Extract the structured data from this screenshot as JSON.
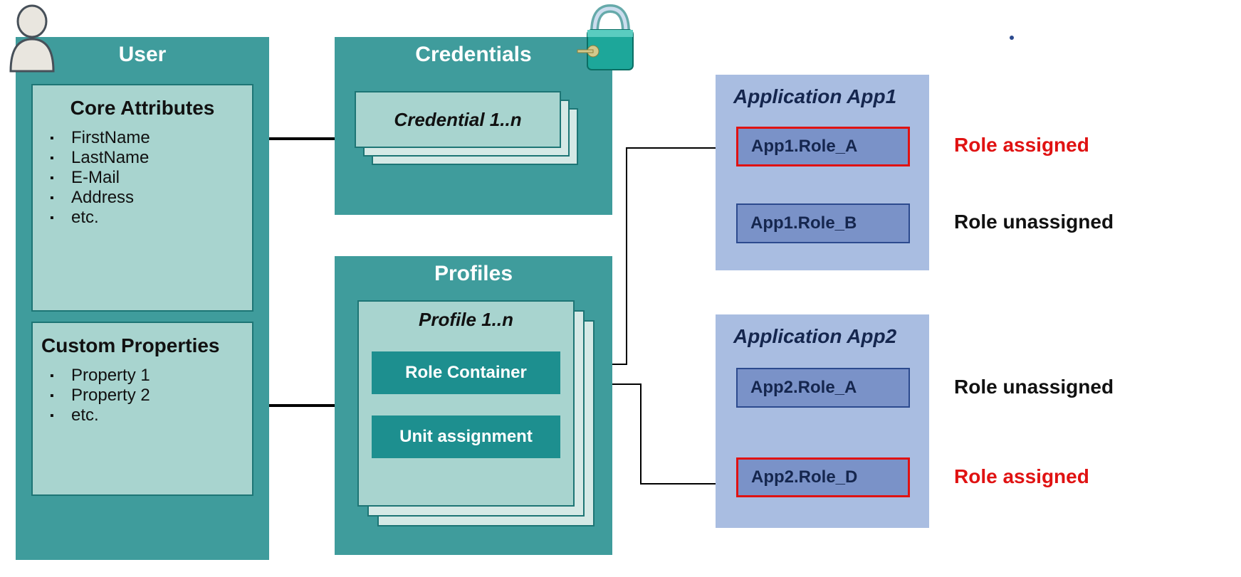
{
  "user": {
    "title": "User",
    "core_attributes": {
      "title": "Core Attributes",
      "items": [
        "FirstName",
        "LastName",
        "E-Mail",
        "Address",
        "etc."
      ]
    },
    "custom_properties": {
      "title": "Custom Properties",
      "items": [
        "Property 1",
        "Property 2",
        "etc."
      ]
    }
  },
  "credentials": {
    "title": "Credentials",
    "card_label": "Credential 1..n"
  },
  "profiles": {
    "title": "Profiles",
    "card_label": "Profile 1..n",
    "role_container_label": "Role Container",
    "unit_assignment_label": "Unit assignment"
  },
  "apps": {
    "app1": {
      "title": "Application App1",
      "roles": [
        {
          "name": "App1.Role_A",
          "assigned": true
        },
        {
          "name": "App1.Role_B",
          "assigned": false
        }
      ]
    },
    "app2": {
      "title": "Application App2",
      "roles": [
        {
          "name": "App2.Role_A",
          "assigned": false
        },
        {
          "name": "App2.Role_D",
          "assigned": true
        }
      ]
    }
  },
  "labels": {
    "assigned": "Role assigned",
    "unassigned": "Role unassigned"
  }
}
